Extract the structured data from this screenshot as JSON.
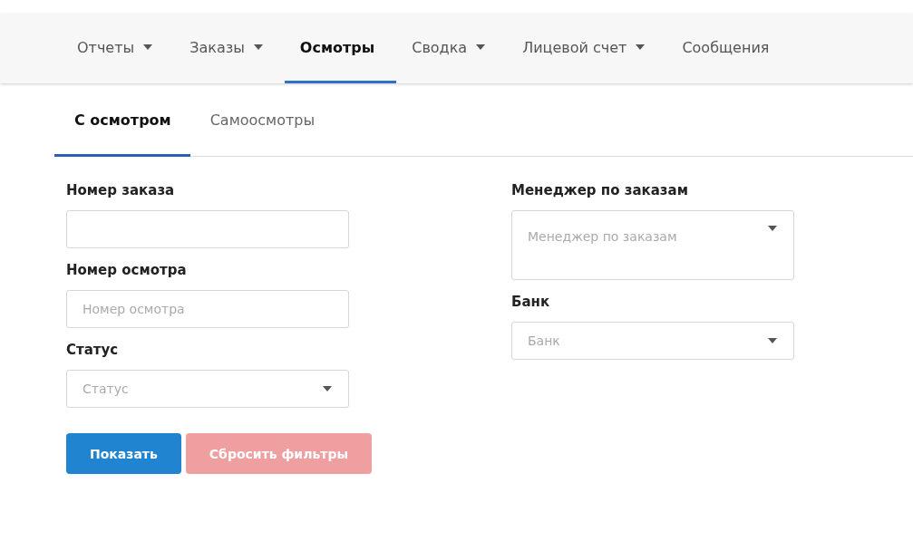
{
  "nav": [
    {
      "label": "Отчеты",
      "dropdown": true,
      "selected": false
    },
    {
      "label": "Заказы",
      "dropdown": true,
      "selected": false
    },
    {
      "label": "Осмотры",
      "dropdown": false,
      "selected": true
    },
    {
      "label": "Сводка",
      "dropdown": true,
      "selected": false
    },
    {
      "label": "Лицевой счет",
      "dropdown": true,
      "selected": false
    },
    {
      "label": "Сообщения",
      "dropdown": false,
      "selected": false
    }
  ],
  "subtabs": [
    {
      "label": "С осмотром",
      "selected": true
    },
    {
      "label": "Самоосмотры",
      "selected": false
    }
  ],
  "left_fields": [
    {
      "label": "Номер заказа",
      "kind": "input"
    },
    {
      "label": "Номер осмотра",
      "kind": "input",
      "placeholder": "Номер осмотра"
    },
    {
      "label": "Статус",
      "kind": "select",
      "placeholder": "Статус"
    }
  ],
  "right_fields": [
    {
      "label": "Менеджер по заказам",
      "kind": "multiselect",
      "placeholder": "Менеджер по заказам"
    },
    {
      "label": "Банк",
      "kind": "select",
      "placeholder": "Банк"
    }
  ],
  "buttons": [
    {
      "label": "Показать",
      "kind": "primary",
      "disabled": false
    },
    {
      "label": "Сбросить фильтры",
      "kind": "danger",
      "disabled": true
    }
  ]
}
